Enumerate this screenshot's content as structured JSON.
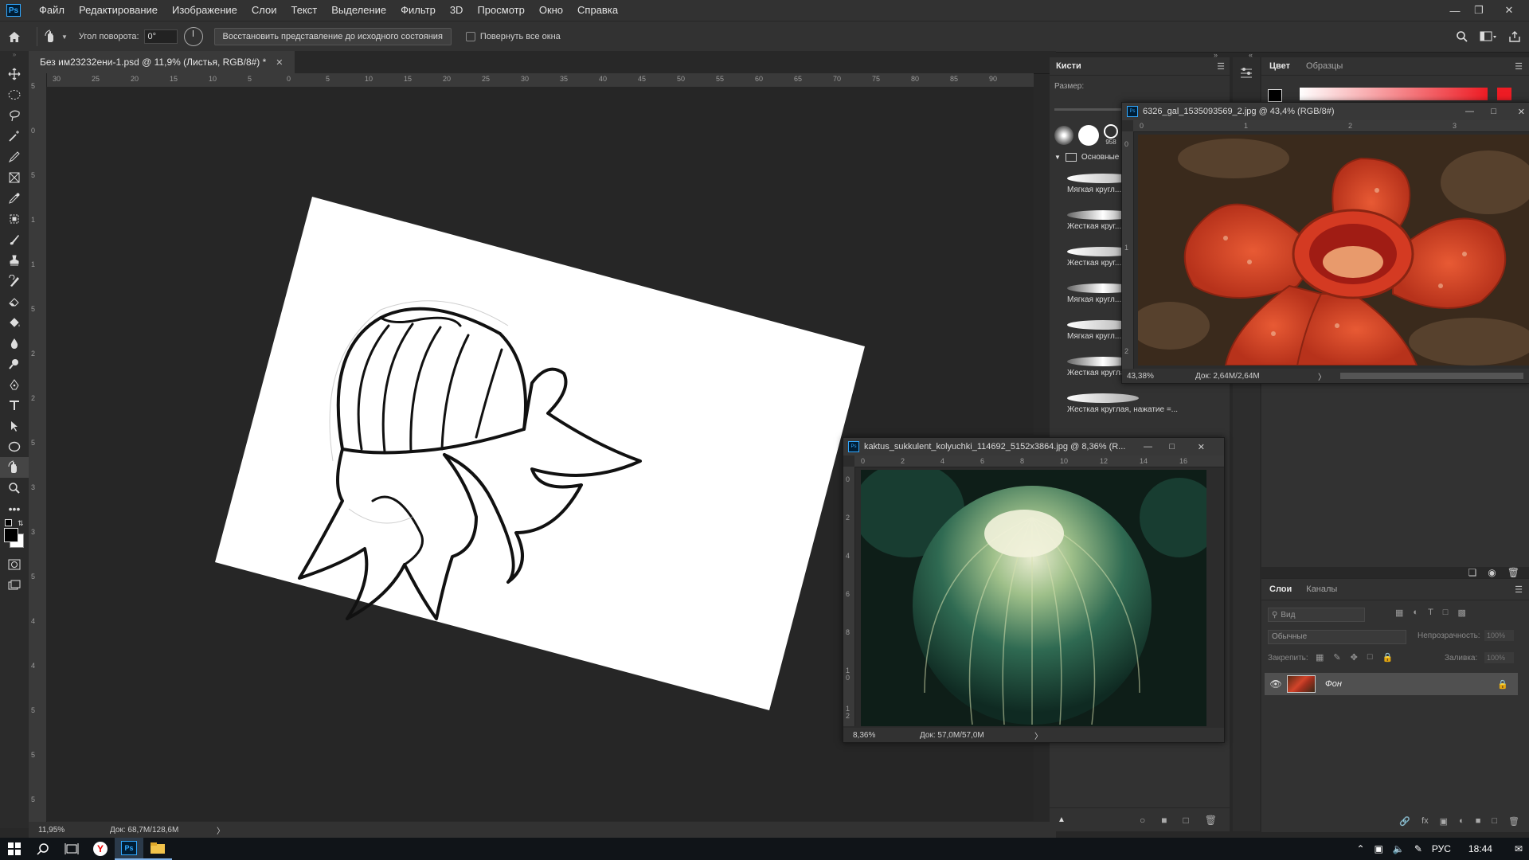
{
  "menu": {
    "logo": "Ps",
    "items": [
      "Файл",
      "Редактирование",
      "Изображение",
      "Слои",
      "Текст",
      "Выделение",
      "Фильтр",
      "3D",
      "Просмотр",
      "Окно",
      "Справка"
    ]
  },
  "options": {
    "rotation_label": "Угол поворота:",
    "rotation_value": "0°",
    "reset_view_label": "Восстановить представление до исходного состояния",
    "rotate_all_label": "Повернуть все окна"
  },
  "document": {
    "tab_title": "Без им23232ени-1.psd @ 11,9% (Листья, RGB/8#) *",
    "zoom": "11,95%",
    "doc_size": "Док: 68,7M/128,6M",
    "ruler_h": [
      "30",
      "25",
      "20",
      "15",
      "10",
      "5",
      "0",
      "5",
      "10",
      "15",
      "20",
      "25",
      "30",
      "35",
      "40",
      "45",
      "50",
      "55",
      "60",
      "65",
      "70",
      "75",
      "80",
      "85",
      "90"
    ],
    "ruler_v": [
      "5",
      "0",
      "5",
      "1",
      "1",
      "5",
      "2",
      "2",
      "5",
      "3",
      "3",
      "5",
      "4",
      "4",
      "5",
      "5",
      "5"
    ]
  },
  "brushes_panel": {
    "tab": "Кисти",
    "size_label": "Размер:",
    "preset_size": "958",
    "group_label": "Основные",
    "items": [
      "Мягкая кругл...",
      "Жесткая круг...",
      "Жесткая круг...",
      "Мягкая кругл...",
      "Мягкая кругл...",
      "Жесткая круглая, нажим = ...",
      "Жесткая круглая, нажатие =..."
    ]
  },
  "color_panel": {
    "tabs": [
      "Цвет",
      "Образцы"
    ],
    "accent": "#ee1c24"
  },
  "float_rafflesia": {
    "title": "6326_gal_1535093569_2.jpg @ 43,4% (RGB/8#)",
    "zoom": "43,38%",
    "doc_size": "Док: 2,64M/2,64M",
    "ruler_h": [
      "0",
      "1",
      "2",
      "3"
    ],
    "ruler_v": [
      "0",
      "1",
      "2"
    ]
  },
  "float_cactus": {
    "title": "kaktus_sukkulent_kolyuchki_114692_5152x3864.jpg @ 8,36% (R...",
    "zoom": "8,36%",
    "doc_size": "Док: 57,0M/57,0M",
    "ruler_h": [
      "0",
      "2",
      "4",
      "6",
      "8",
      "10",
      "12",
      "14",
      "16"
    ],
    "ruler_v": [
      "0",
      "2",
      "4",
      "6",
      "8",
      "1\n0",
      "1\n2"
    ]
  },
  "layers_panel": {
    "tabs": [
      "Слои",
      "Каналы"
    ],
    "search_placeholder": "Вид",
    "blend_mode": "Обычные",
    "opacity_label": "Непрозрачность:",
    "opacity_value": "100%",
    "lock_label": "Закрепить:",
    "fill_label": "Заливка:",
    "fill_value": "100%",
    "layer_name": "Фон"
  },
  "taskbar": {
    "lang": "РУС",
    "time": "18:44"
  }
}
